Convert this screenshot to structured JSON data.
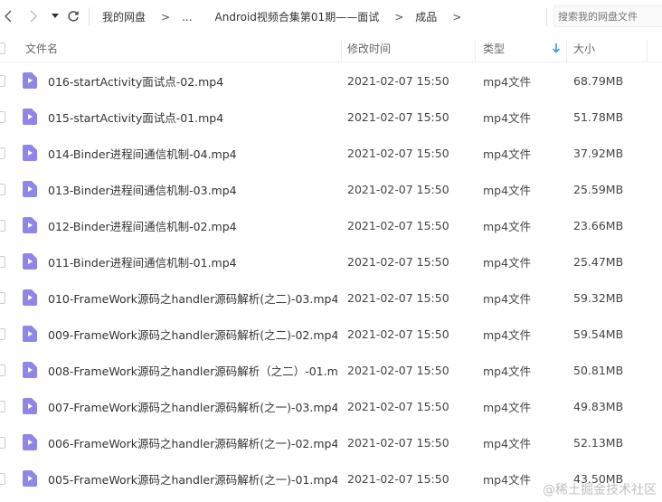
{
  "toolbar": {
    "breadcrumb": {
      "root": "我的网盘",
      "ellipsis": "...",
      "folder1": "Android视频合集第01期——面试",
      "folder2": "成品",
      "separator": ">"
    },
    "search_placeholder": "搜索我的网盘文件"
  },
  "columns": {
    "name": "文件名",
    "modified": "修改时间",
    "type": "类型",
    "size": "大小"
  },
  "files": [
    {
      "name": "016-startActivity面试点-02.mp4",
      "modified": "2021-02-07 15:50",
      "type": "mp4文件",
      "size": "68.79MB"
    },
    {
      "name": "015-startActivity面试点-01.mp4",
      "modified": "2021-02-07 15:50",
      "type": "mp4文件",
      "size": "51.78MB"
    },
    {
      "name": "014-Binder进程间通信机制-04.mp4",
      "modified": "2021-02-07 15:50",
      "type": "mp4文件",
      "size": "37.92MB"
    },
    {
      "name": "013-Binder进程间通信机制-03.mp4",
      "modified": "2021-02-07 15:50",
      "type": "mp4文件",
      "size": "25.59MB"
    },
    {
      "name": "012-Binder进程间通信机制-02.mp4",
      "modified": "2021-02-07 15:50",
      "type": "mp4文件",
      "size": "23.66MB"
    },
    {
      "name": "011-Binder进程间通信机制-01.mp4",
      "modified": "2021-02-07 15:50",
      "type": "mp4文件",
      "size": "25.47MB"
    },
    {
      "name": "010-FrameWork源码之handler源码解析(之二)-03.mp4",
      "modified": "2021-02-07 15:50",
      "type": "mp4文件",
      "size": "59.32MB"
    },
    {
      "name": "009-FrameWork源码之handler源码解析(之二)-02.mp4",
      "modified": "2021-02-07 15:50",
      "type": "mp4文件",
      "size": "59.54MB"
    },
    {
      "name": "008-FrameWork源码之handler源码解析（之二）-01.m...",
      "modified": "2021-02-07 15:50",
      "type": "mp4文件",
      "size": "50.81MB"
    },
    {
      "name": "007-FrameWork源码之handler源码解析(之一)-03.mp4",
      "modified": "2021-02-07 15:50",
      "type": "mp4文件",
      "size": "49.83MB"
    },
    {
      "name": "006-FrameWork源码之handler源码解析(之一)-02.mp4",
      "modified": "2021-02-07 15:50",
      "type": "mp4文件",
      "size": "52.13MB"
    },
    {
      "name": "005-FrameWork源码之handler源码解析(之一)-01.mp4",
      "modified": "2021-02-07 15:50",
      "type": "mp4文件",
      "size": "43.50MB"
    }
  ],
  "watermark": "@稀土掘金技术社区",
  "colors": {
    "file_icon": "#8e87e8",
    "sort_arrow": "#2a8cf0"
  }
}
